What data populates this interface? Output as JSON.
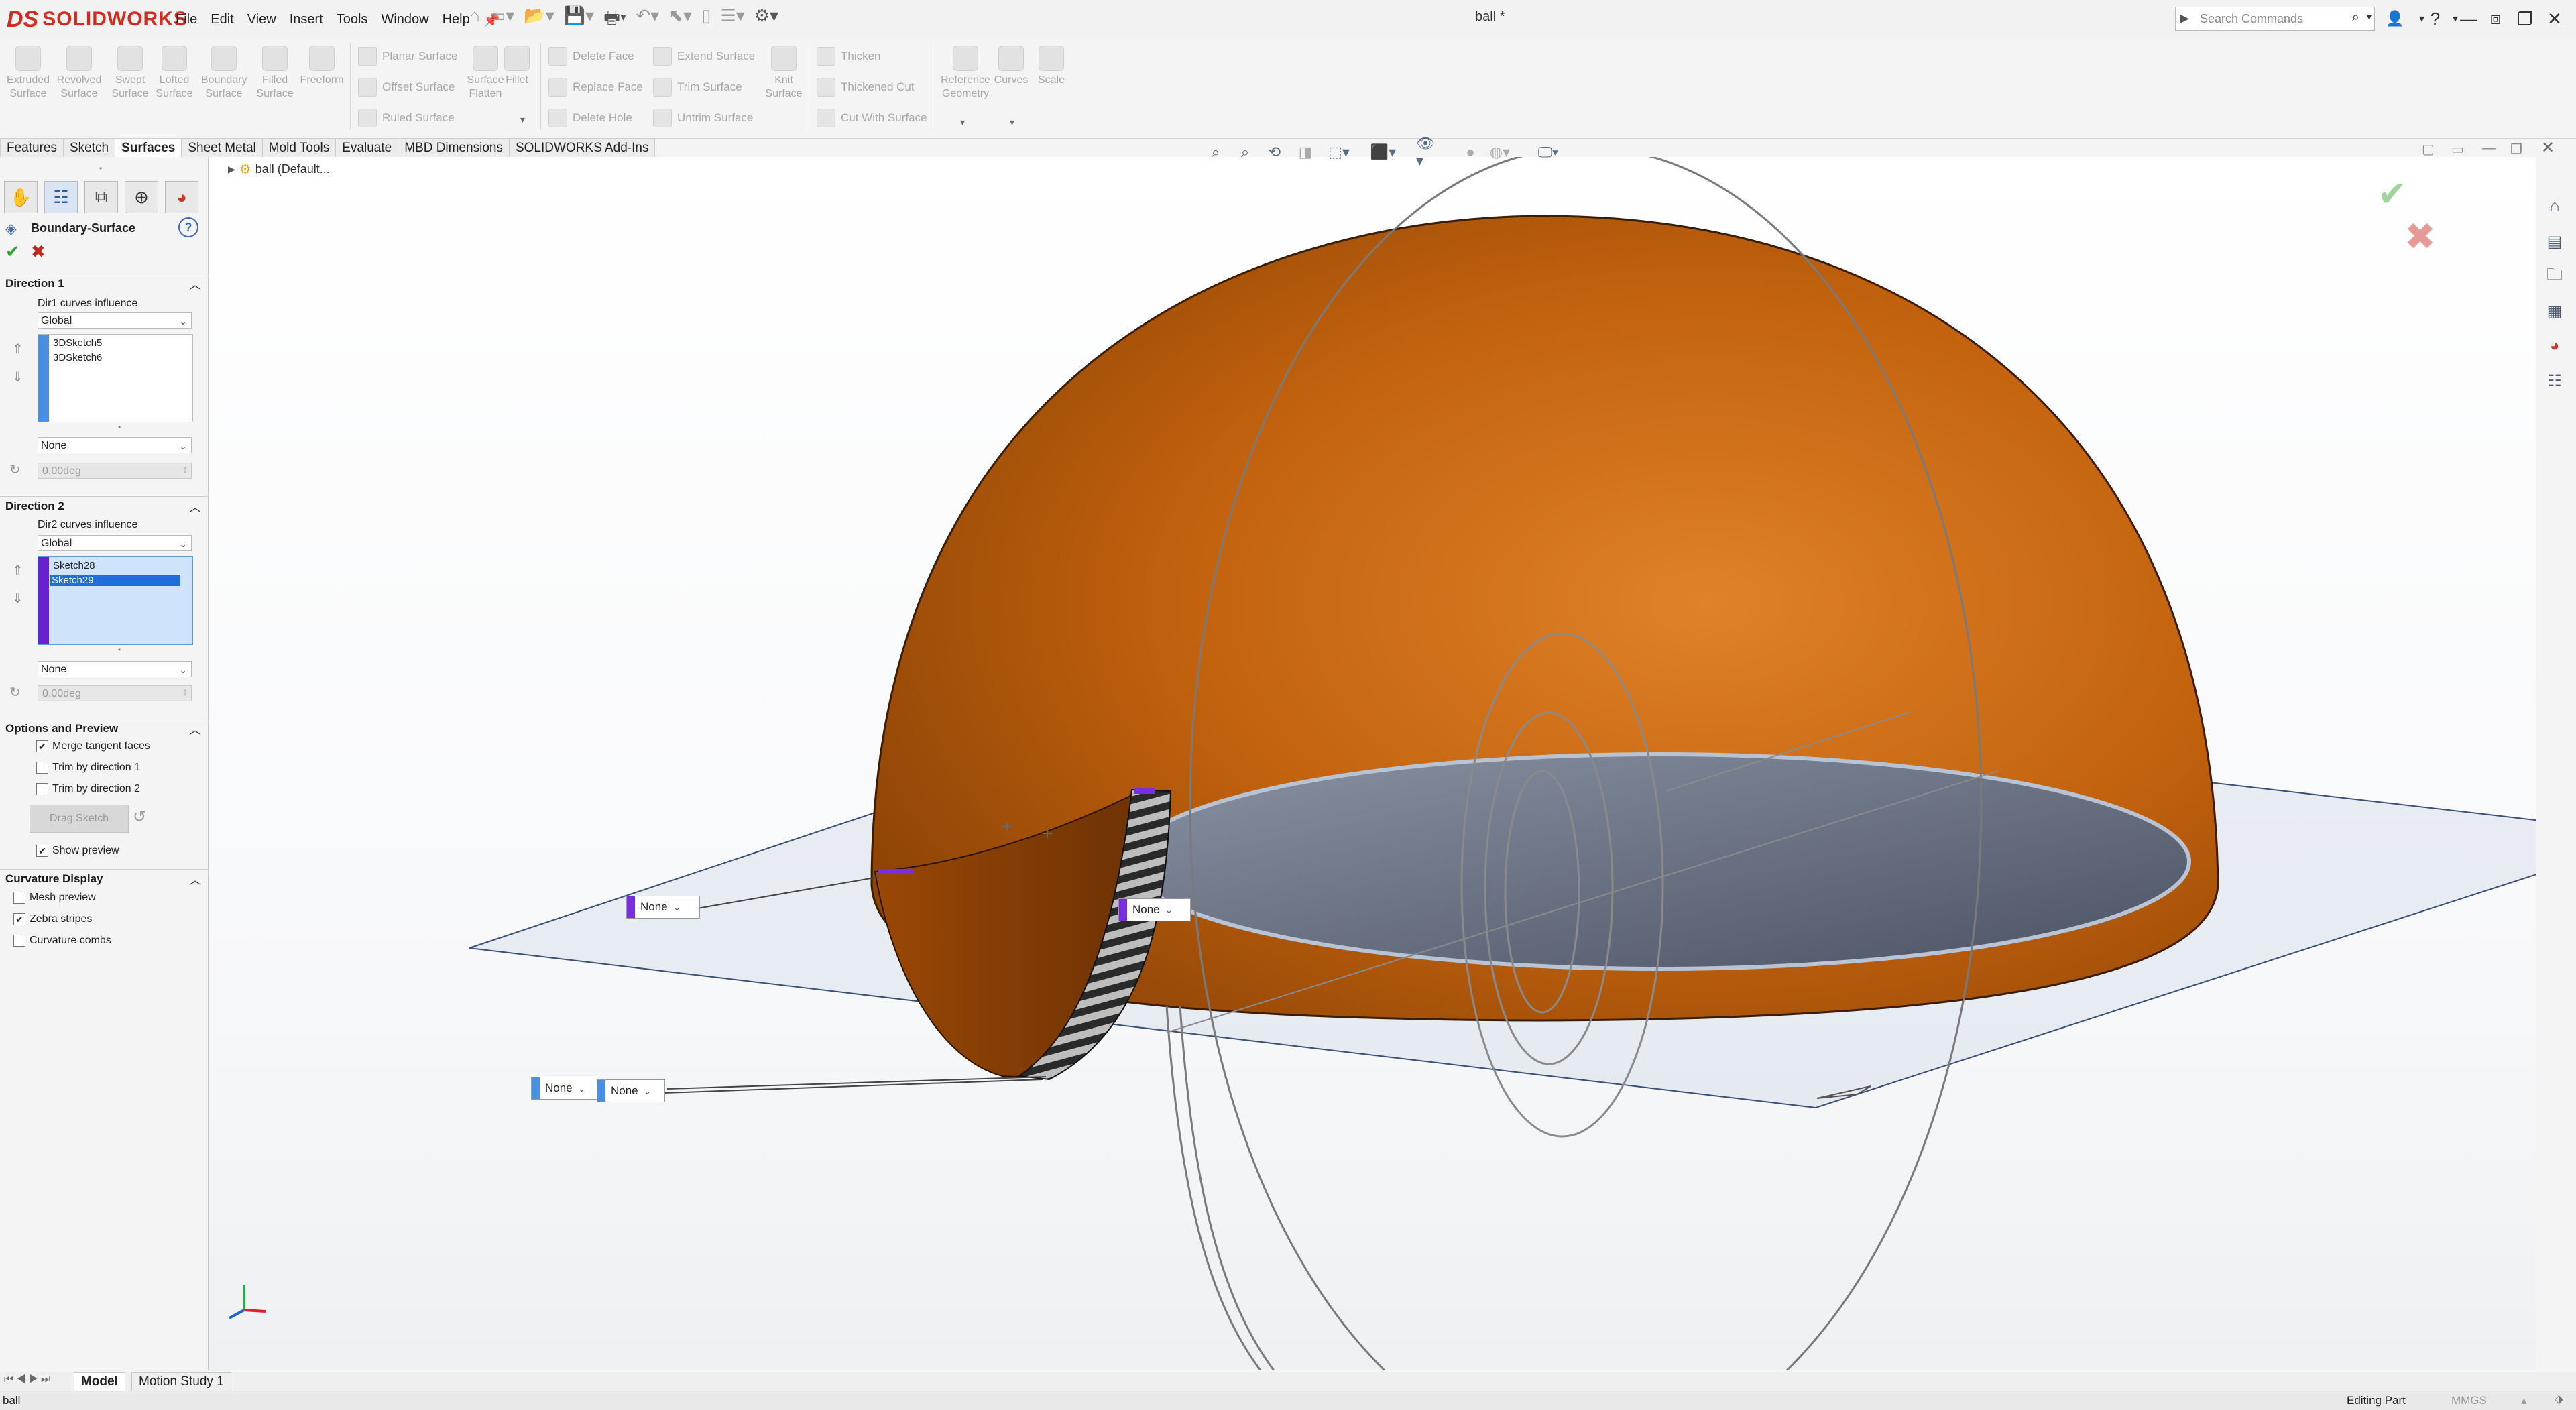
{
  "app": {
    "brand_prefix": "DS",
    "brand": "SOLIDWORKS",
    "document_title": "ball *"
  },
  "menu": [
    "File",
    "Edit",
    "View",
    "Insert",
    "Tools",
    "Window",
    "Help"
  ],
  "search": {
    "placeholder": "Search Commands"
  },
  "toolbar": {
    "large_tools": [
      {
        "label": "Extruded Surface",
        "icon": "extruded-surface-icon"
      },
      {
        "label": "Revolved Surface",
        "icon": "revolved-surface-icon"
      },
      {
        "label": "Swept Surface",
        "icon": "swept-surface-icon"
      },
      {
        "label": "Lofted Surface",
        "icon": "lofted-surface-icon"
      },
      {
        "label": "Boundary Surface",
        "icon": "boundary-surface-icon"
      },
      {
        "label": "Filled Surface",
        "icon": "filled-surface-icon"
      },
      {
        "label": "Freeform",
        "icon": "freeform-icon"
      }
    ],
    "col1": [
      "Planar Surface",
      "Offset Surface",
      "Ruled Surface"
    ],
    "mid_tools": [
      {
        "label": "Surface Flatten",
        "icon": "surface-flatten-icon"
      },
      {
        "label": "Fillet",
        "icon": "fillet-icon"
      }
    ],
    "col2": [
      "Delete Face",
      "Replace Face",
      "Delete Hole"
    ],
    "col3": [
      "Extend Surface",
      "Trim Surface",
      "Untrim Surface"
    ],
    "knit": {
      "label": "Knit Surface",
      "icon": "knit-surface-icon"
    },
    "col4": [
      "Thicken",
      "Thickened Cut",
      "Cut With Surface"
    ],
    "right_tools": [
      {
        "label": "Reference Geometry",
        "icon": "reference-geometry-icon"
      },
      {
        "label": "Curves",
        "icon": "curves-icon"
      },
      {
        "label": "Scale",
        "icon": "scale-icon"
      }
    ]
  },
  "tabs": [
    "Features",
    "Sketch",
    "Surfaces",
    "Sheet Metal",
    "Mold Tools",
    "Evaluate",
    "MBD Dimensions",
    "SOLIDWORKS Add-Ins"
  ],
  "active_tab": "Surfaces",
  "property_manager": {
    "title": "Boundary-Surface",
    "direction1": {
      "header": "Direction 1",
      "influence_label": "Dir1 curves influence",
      "influence_value": "Global",
      "curves": [
        "3DSketch5",
        "3DSketch6"
      ],
      "tangency": "None",
      "angle": "0.00deg"
    },
    "direction2": {
      "header": "Direction 2",
      "influence_label": "Dir2 curves influence",
      "influence_value": "Global",
      "curves": [
        "Sketch28",
        "Sketch29"
      ],
      "selected_curve": "Sketch29",
      "tangency": "None",
      "angle": "0.00deg"
    },
    "options": {
      "header": "Options and Preview",
      "merge_tangent": "Merge tangent faces",
      "trim_dir1": "Trim by direction 1",
      "trim_dir2": "Trim by direction 2",
      "drag_sketch": "Drag Sketch",
      "show_preview": "Show preview"
    },
    "curvature": {
      "header": "Curvature Display",
      "mesh_preview": "Mesh preview",
      "zebra": "Zebra stripes",
      "combs": "Curvature combs"
    },
    "checkbox_states": {
      "merge_tangent": true,
      "trim_dir1": false,
      "trim_dir2": false,
      "show_preview": true,
      "mesh_preview": false,
      "zebra": true,
      "combs": false
    }
  },
  "feature_tree": {
    "root": "ball  (Default..."
  },
  "viewport_tags": [
    "None",
    "None",
    "None",
    "None"
  ],
  "colors": {
    "dome": "#b85a0c",
    "inner_disk": "#5d6678",
    "dir1_color": "#4a90e2",
    "dir2_color": "#6a1fd0",
    "accent": "#1e6fd9"
  },
  "bottom_tabs": [
    "Model",
    "Motion Study 1"
  ],
  "status": {
    "left": "ball",
    "mode": "Editing Part",
    "units": "MMGS"
  }
}
